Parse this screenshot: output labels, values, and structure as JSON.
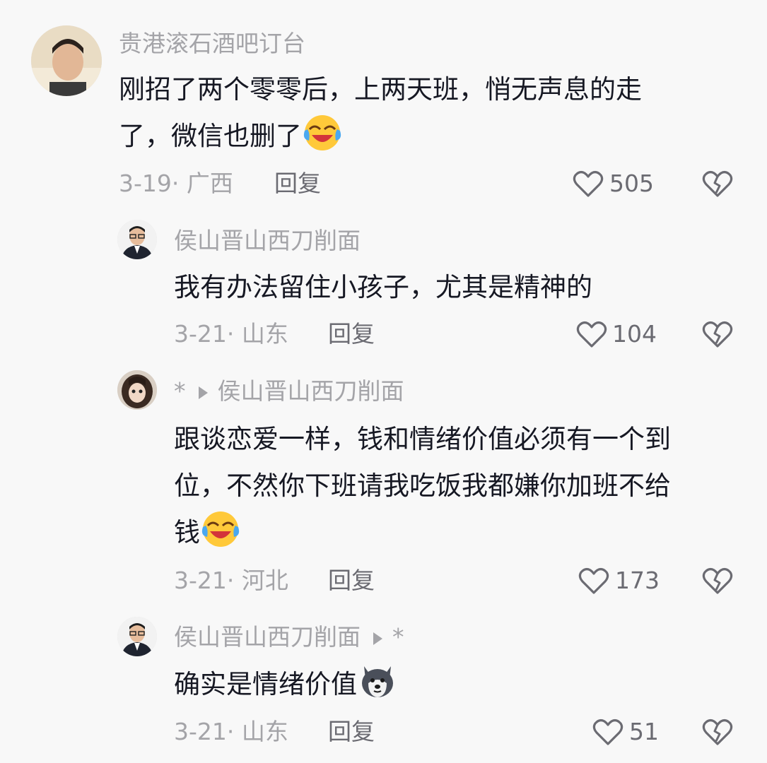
{
  "comments": [
    {
      "username": "贵港滚石酒吧订台",
      "text_line1": "刚招了两个零零后，上两天班，悄无声息的走",
      "text_line2": "了，微信也删了",
      "emoji": "laughing-crying-emoji",
      "date": "3-19",
      "location": "广西",
      "reply_label": "回复",
      "likes": "505"
    },
    {
      "username": "侯山晋山西刀削面",
      "text_line1": "我有办法留住小孩子，尤其是精神的",
      "date": "3-21",
      "location": "山东",
      "reply_label": "回复",
      "likes": "104"
    },
    {
      "username_prefix": "*",
      "reply_to": "侯山晋山西刀削面",
      "text_line1": "跟谈恋爱一样，钱和情绪价值必须有一个到",
      "text_line2": "位，不然你下班请我吃饭我都嫌你加班不给",
      "text_line3": "钱",
      "emoji": "laughing-crying-emoji",
      "date": "3-21",
      "location": "河北",
      "reply_label": "回复",
      "likes": "173"
    },
    {
      "username": "侯山晋山西刀削面",
      "reply_to": "*",
      "text_line1": "确实是情绪价值",
      "emoji": "husky-dog-emoji",
      "date": "3-21",
      "location": "山东",
      "reply_label": "回复",
      "likes": "51"
    }
  ],
  "colors": {
    "background": "#f8f8f8",
    "text": "#161823",
    "secondary": "#a4a4a8",
    "icon": "#6b6b72"
  }
}
